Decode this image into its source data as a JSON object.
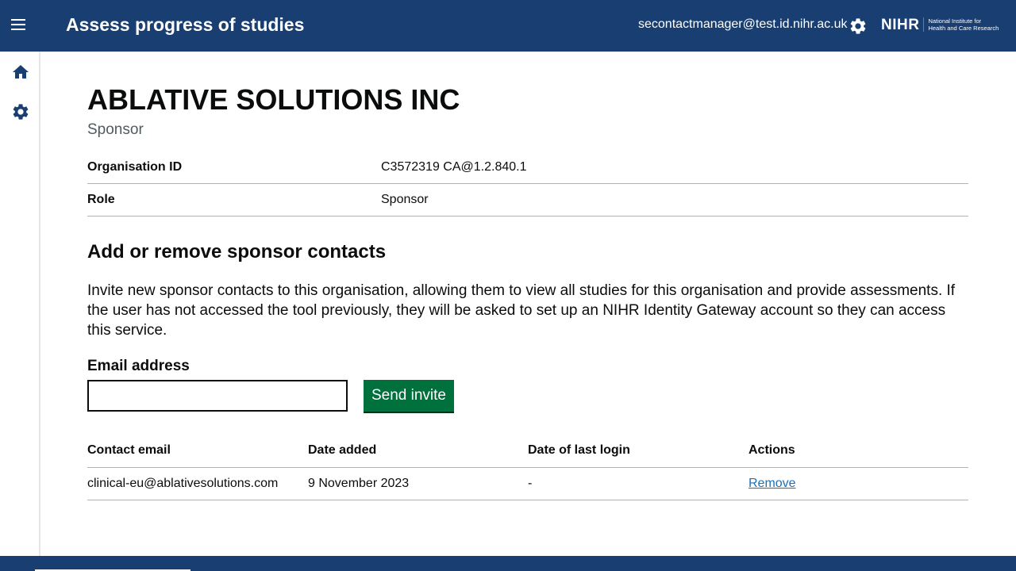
{
  "header": {
    "menu_icon": "hamburger-icon",
    "title": "Assess progress of studies",
    "user_email": "secontactmanager@test.id.nihr.ac.uk",
    "settings_icon": "gear-icon",
    "logo": {
      "word": "NIHR",
      "line1": "National Institute for",
      "line2": "Health and Care Research"
    }
  },
  "sidebar": {
    "items": [
      {
        "icon": "home-icon"
      },
      {
        "icon": "gear-icon"
      }
    ]
  },
  "organisation": {
    "name": "ABLATIVE SOLUTIONS INC",
    "caption": "Sponsor",
    "summary": [
      {
        "key": "Organisation ID",
        "value": "C3572319 CA@1.2.840.1"
      },
      {
        "key": "Role",
        "value": "Sponsor"
      }
    ]
  },
  "contacts_section": {
    "heading": "Add or remove sponsor contacts",
    "body": "Invite new sponsor contacts to this organisation, allowing them to view all studies for this organisation and provide assessments. If the user has not accessed the tool previously, they will be asked to set up an NIHR Identity Gateway account so they can access this service.",
    "email_label": "Email address",
    "email_value": "",
    "send_label": "Send invite"
  },
  "contacts_table": {
    "headers": [
      "Contact email",
      "Date added",
      "Date of last login",
      "Actions"
    ],
    "rows": [
      {
        "email": "clinical-eu@ablativesolutions.com",
        "date_added": "9 November 2023",
        "last_login": "-",
        "action": "Remove"
      }
    ]
  },
  "colors": {
    "brand_blue": "#193e72",
    "button_green": "#00703c",
    "link_blue": "#1d70b8",
    "nihr_accent": "#e8494f"
  }
}
